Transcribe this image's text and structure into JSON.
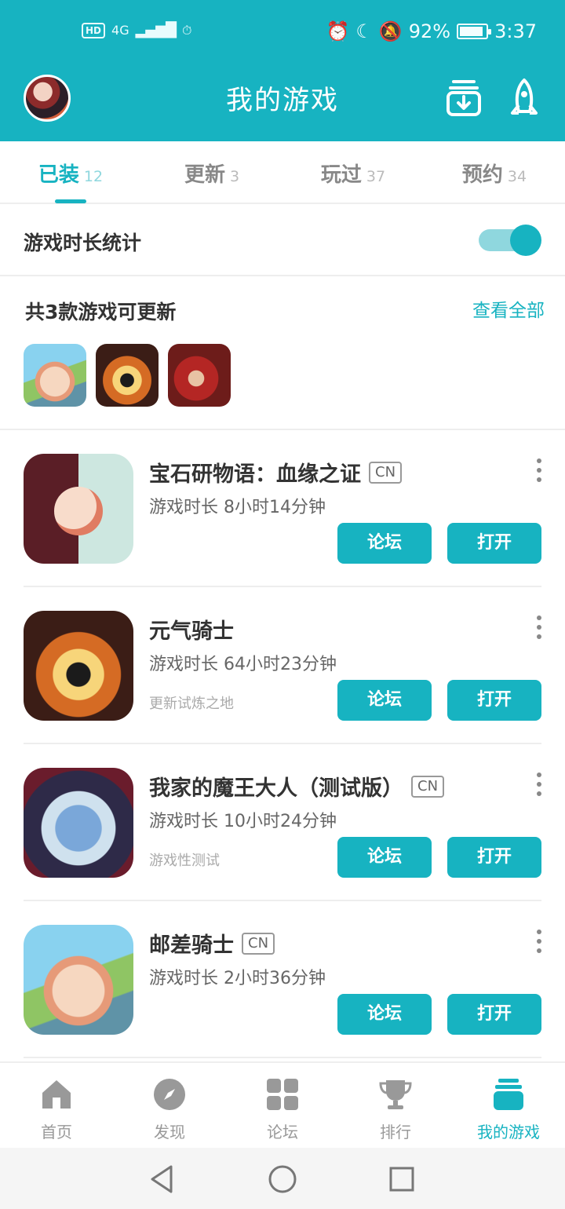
{
  "status_bar": {
    "hd": "HD",
    "network": "4G",
    "battery": "92%",
    "battery_level": 0.92,
    "time": "3:37"
  },
  "header": {
    "title": "我的游戏",
    "download_icon": "download-tray-icon",
    "rocket_icon": "rocket-icon"
  },
  "tabs": [
    {
      "label": "已装",
      "count": "12",
      "active": true
    },
    {
      "label": "更新",
      "count": "3"
    },
    {
      "label": "玩过",
      "count": "37"
    },
    {
      "label": "预约",
      "count": "34"
    }
  ],
  "toggle": {
    "label": "游戏时长统计",
    "on": true
  },
  "updates": {
    "title": "共3款游戏可更新",
    "link": "查看全部"
  },
  "games": [
    {
      "name": "宝石研物语：血缘之证",
      "region": "CN",
      "playtime": "游戏时长 8小时14分钟",
      "subtitle": "",
      "forum": "论坛",
      "open": "打开"
    },
    {
      "name": "元气骑士",
      "region": "",
      "playtime": "游戏时长 64小时23分钟",
      "subtitle": "更新试炼之地",
      "forum": "论坛",
      "open": "打开"
    },
    {
      "name": "我家的魔王大人（测试版）",
      "region": "CN",
      "playtime": "游戏时长 10小时24分钟",
      "subtitle": "游戏性测试",
      "forum": "论坛",
      "open": "打开"
    },
    {
      "name": "邮差骑士",
      "region": "CN",
      "playtime": "游戏时长 2小时36分钟",
      "subtitle": "",
      "forum": "论坛",
      "open": "打开"
    }
  ],
  "bottom_nav": [
    {
      "label": "首页",
      "icon": "home-icon"
    },
    {
      "label": "发现",
      "icon": "compass-icon"
    },
    {
      "label": "论坛",
      "icon": "grid-icon"
    },
    {
      "label": "排行",
      "icon": "trophy-icon"
    },
    {
      "label": "我的游戏",
      "icon": "stack-icon",
      "active": true
    }
  ],
  "colors": {
    "accent": "#17b3c1",
    "accent_light": "#8fd7de"
  }
}
